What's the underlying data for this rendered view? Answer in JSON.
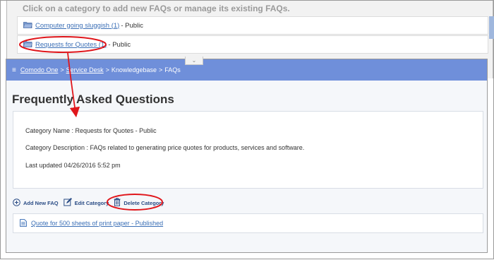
{
  "instruction": "Click on a category to add new FAQs or manage its existing FAQs.",
  "categories": [
    {
      "name": "Computer going sluggish (1)",
      "visibility": " - Public"
    },
    {
      "name": "Requests for Quotes (1)",
      "visibility": " - Public"
    }
  ],
  "breadcrumb": {
    "menu_icon": "≡",
    "items": [
      "Comodo One",
      "Service Desk",
      "Knowledgebase",
      "FAQs"
    ],
    "separator": ">"
  },
  "collapse_icon": "⌄",
  "page_title": "Frequently Asked Questions",
  "category_info": {
    "name_line": "Category Name : Requests for Quotes - Public",
    "description_line": "Category Description : FAQs related to generating price quotes for products, services and software.",
    "updated_line": "Last updated 04/26/2016 5:52 pm"
  },
  "actions": {
    "add": "Add New FAQ",
    "edit": "Edit Category",
    "delete": "Delete Category"
  },
  "faqs": [
    {
      "title": "Quote for 500 sheets of print paper - Published"
    }
  ],
  "colors": {
    "topbar": "#6f8fda",
    "link": "#3b6fb6",
    "annotation": "#e0161b",
    "action_text": "#2b4d86"
  }
}
